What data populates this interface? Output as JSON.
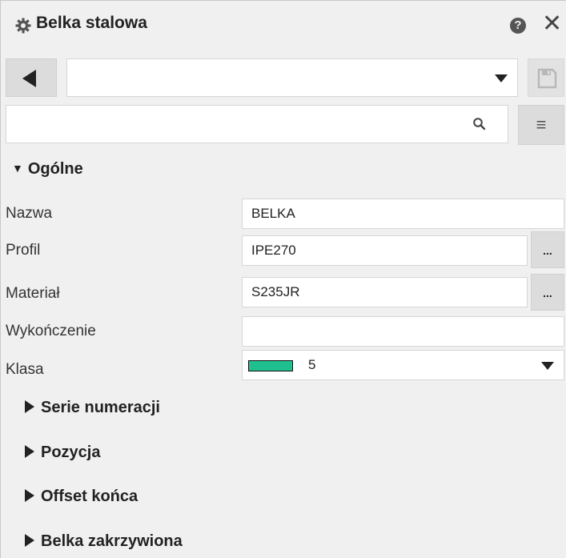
{
  "window": {
    "title": "Belka stalowa",
    "help_symbol": "?",
    "close_symbol": "✕"
  },
  "toolbar": {
    "preset_value": "",
    "search_value": "",
    "menu_symbol": "≡"
  },
  "sections": {
    "general": {
      "label": "Ogólne",
      "expanded_arrow": "▼",
      "rows": {
        "name": {
          "label": "Nazwa",
          "value": "BELKA"
        },
        "profile": {
          "label": "Profil",
          "value": "IPE270",
          "browse": "..."
        },
        "material": {
          "label": "Materiał",
          "value": "S235JR",
          "browse": "..."
        },
        "finish": {
          "label": "Wykończenie",
          "value": ""
        },
        "class": {
          "label": "Klasa",
          "value": "5",
          "color": "#1fbf8f"
        }
      }
    },
    "numbering": {
      "label": "Serie numeracji"
    },
    "position": {
      "label": "Pozycja"
    },
    "end_offset": {
      "label": "Offset końca"
    },
    "curved": {
      "label": "Belka zakrzywiona"
    }
  }
}
